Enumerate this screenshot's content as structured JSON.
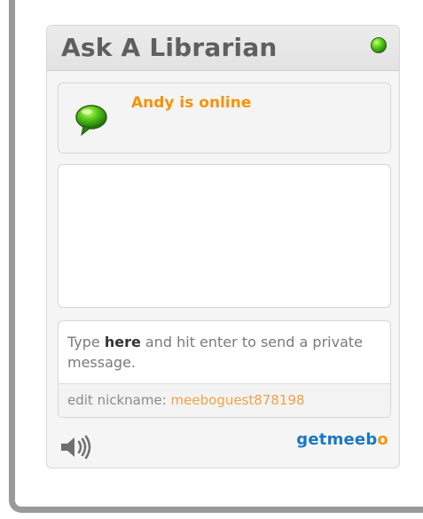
{
  "widget": {
    "title": "Ask A Librarian",
    "status_text": "Andy is online",
    "compose": {
      "prefix": "Type ",
      "emphasis": "here",
      "suffix": " and hit enter to send a private message."
    },
    "nickname": {
      "label": "edit nickname: ",
      "value": "meeboguest878198"
    },
    "branding": {
      "get": "get",
      "brand": "meeb",
      "last_letter": "o"
    }
  },
  "icons": {
    "status": "green-status-dot-icon",
    "chat": "chat-bubble-icon",
    "sound": "speaker-icon"
  },
  "colors": {
    "accent": "#f2940a",
    "brand": "#1a78c2",
    "nickname": "#f0a24a",
    "status_green": "#5fd21f"
  }
}
